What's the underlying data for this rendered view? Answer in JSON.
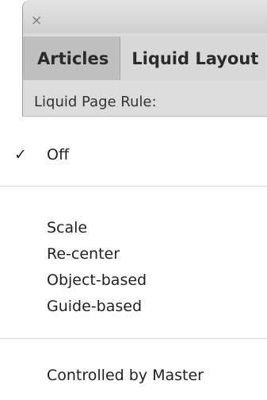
{
  "panel": {
    "close_glyph": "×",
    "tabs": [
      {
        "label": "Articles",
        "active": true
      },
      {
        "label": "Liquid Layout",
        "active": false
      }
    ],
    "label": "Liquid Page Rule:"
  },
  "menu": {
    "items": [
      {
        "label": "Off",
        "checked": true
      },
      {
        "label": "Scale",
        "checked": false
      },
      {
        "label": "Re-center",
        "checked": false
      },
      {
        "label": "Object-based",
        "checked": false
      },
      {
        "label": "Guide-based",
        "checked": false
      },
      {
        "label": "Controlled by Master",
        "checked": false
      }
    ],
    "check_glyph": "✓"
  },
  "colors": {
    "panel_bg": "#dcdcdc",
    "active_tab_bg": "#bfbfbf",
    "menu_bg": "#ffffff",
    "text": "#222222"
  }
}
